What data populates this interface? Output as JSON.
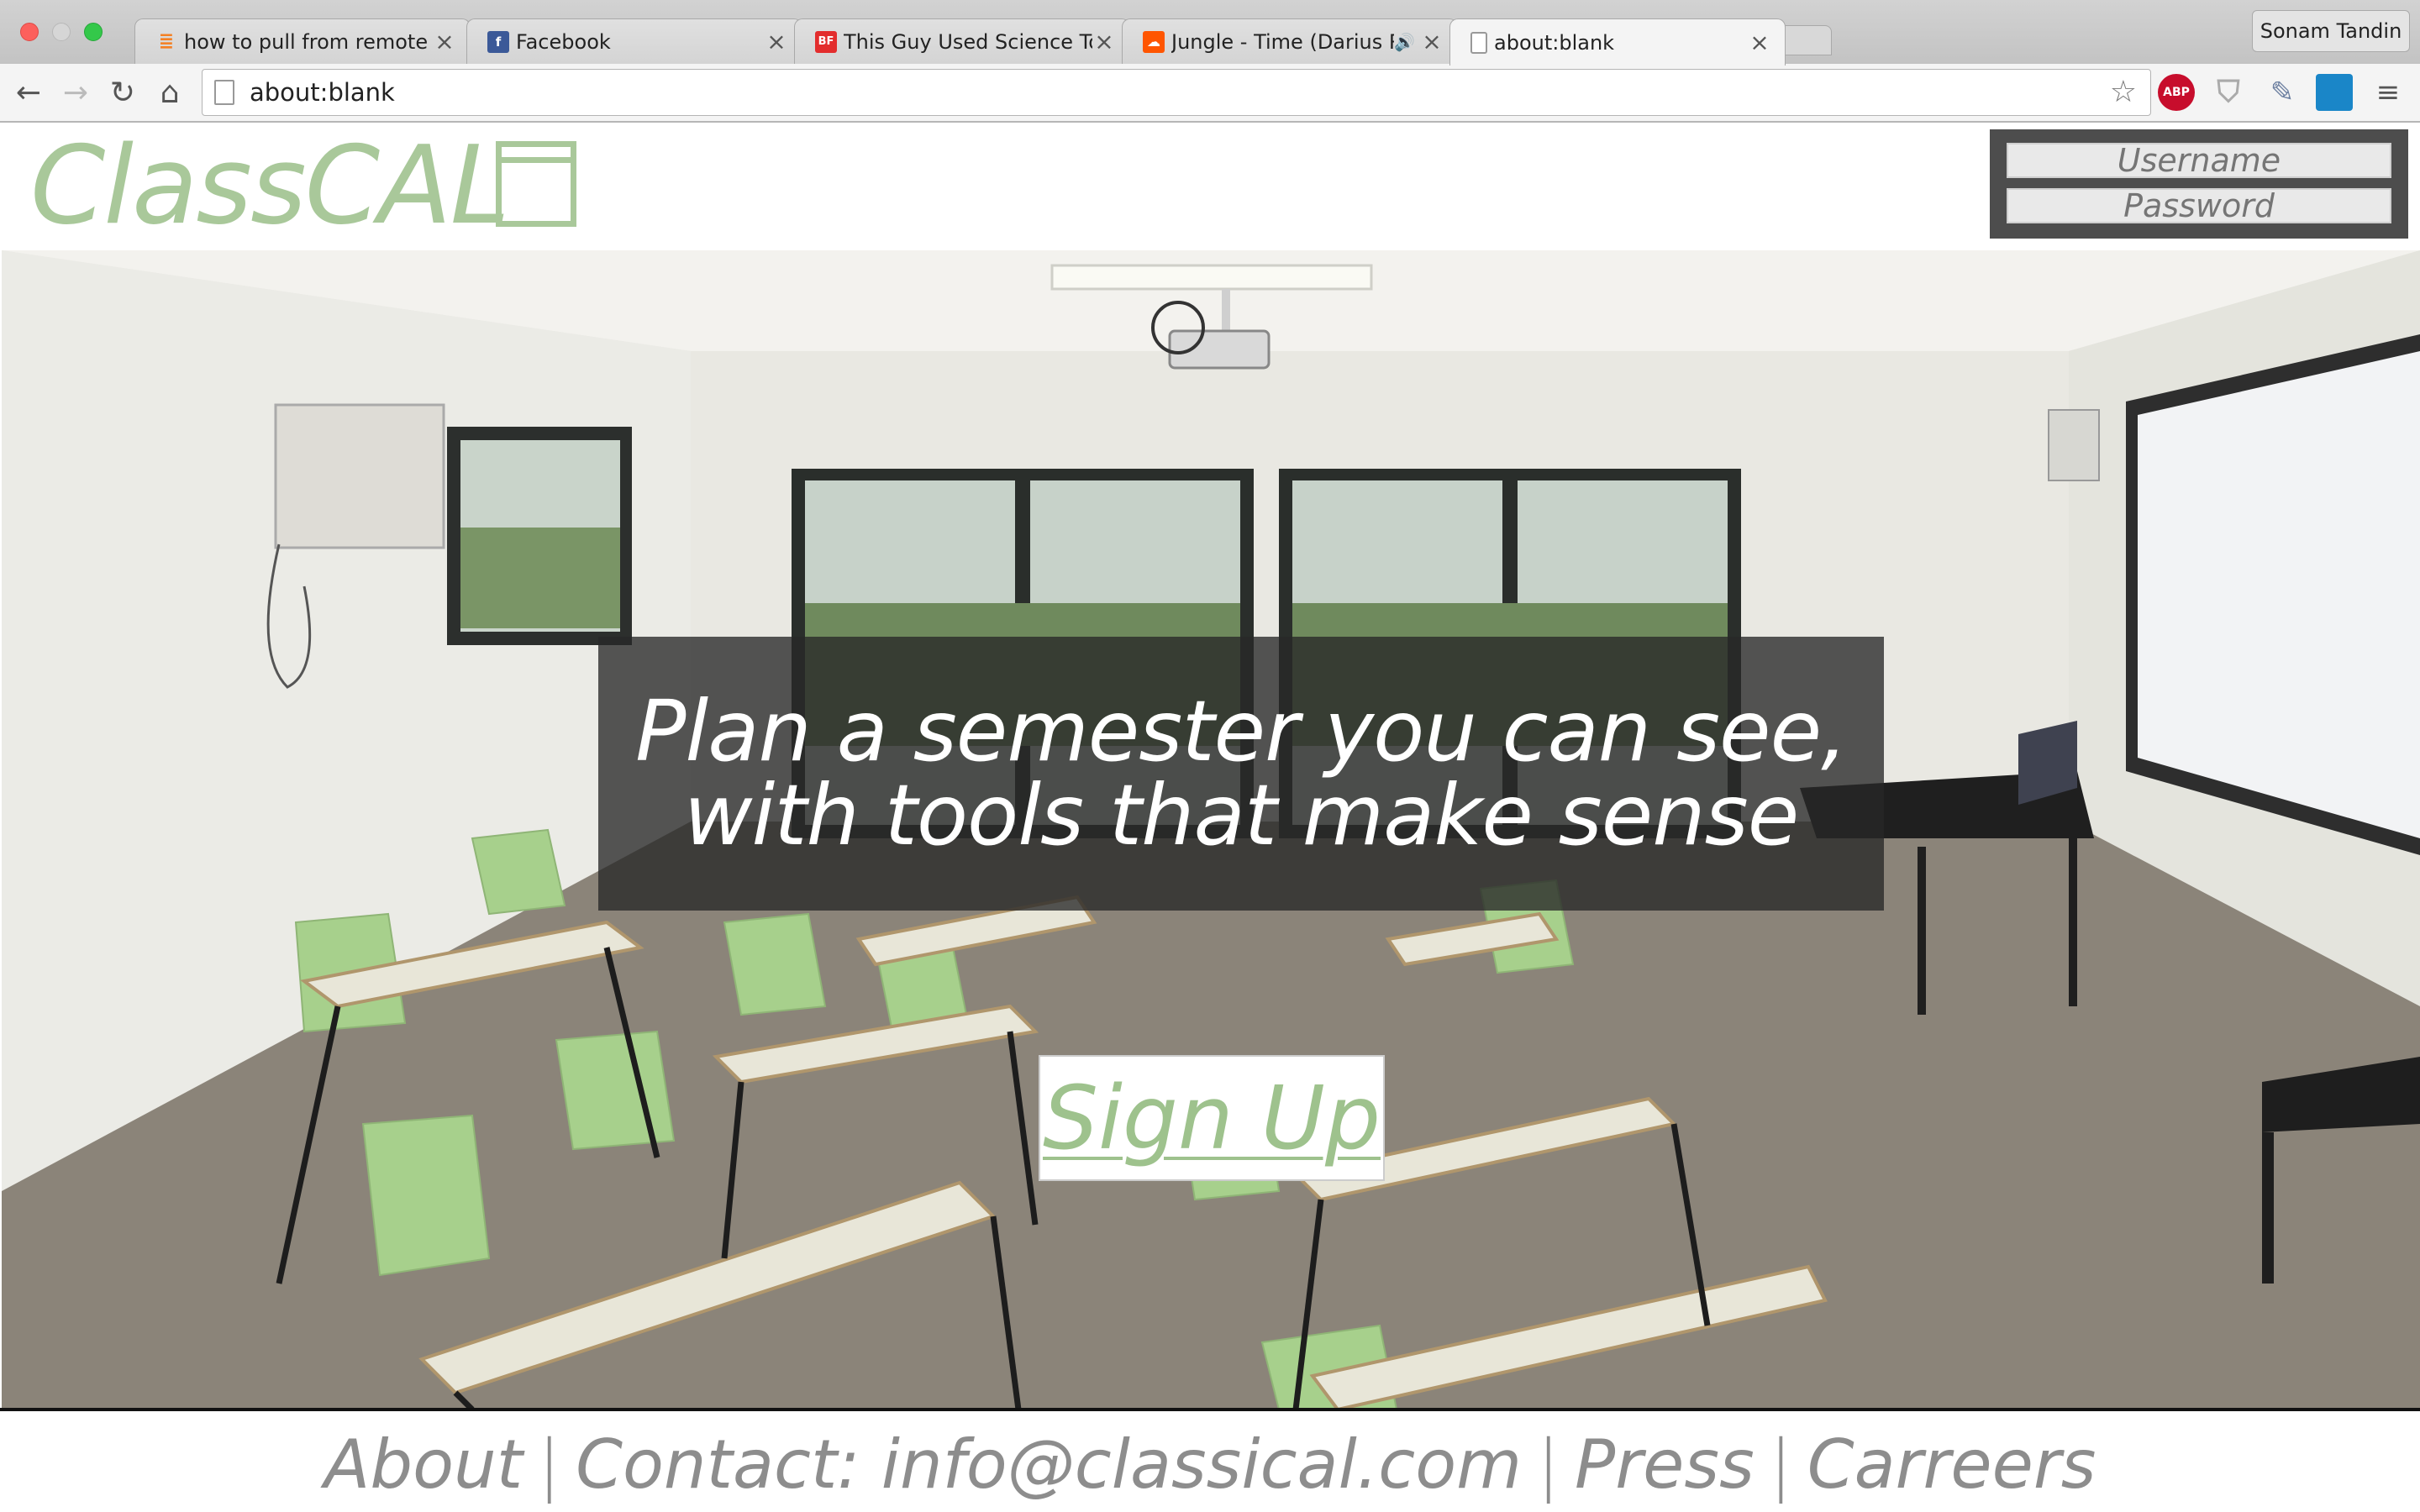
{
  "browser": {
    "profile_name": "Sonam Tandin",
    "url": "about:blank",
    "tabs": [
      {
        "title": "how to pull from remote git",
        "favicon": "stackoverflow-icon",
        "favicon_color": "#f48024"
      },
      {
        "title": "Facebook",
        "favicon": "facebook-icon",
        "favicon_color": "#3b5998",
        "favicon_text": "f"
      },
      {
        "title": "This Guy Used Science To",
        "favicon": "buzzfeed-icon",
        "favicon_color": "#e32d2d",
        "favicon_text": "BF"
      },
      {
        "title": "Jungle - Time (Darius Re",
        "favicon": "soundcloud-icon",
        "favicon_color": "#ff5500",
        "playing_audio": true
      },
      {
        "title": "about:blank",
        "favicon": "page-icon",
        "active": true
      }
    ],
    "extensions": [
      {
        "name": "adblock-plus-icon",
        "label": "ABP",
        "color": "#c70d2c"
      },
      {
        "name": "shield-icon",
        "label": "",
        "color": "#bcbcbc"
      },
      {
        "name": "eyedropper-icon",
        "label": "",
        "color": "#6c7fa0"
      },
      {
        "name": "extension-icon",
        "label": "",
        "color": "#1a86c8"
      }
    ]
  },
  "site": {
    "logo_text": "ClassCAL",
    "login": {
      "username_placeholder": "Username",
      "password_placeholder": "Password"
    },
    "hero": {
      "tagline_line1": "Plan a semester you can see,",
      "tagline_line2": "with tools that make sense",
      "cta_label": "Sign Up"
    },
    "footer": {
      "about": "About",
      "contact": "Contact: info@classical.com",
      "press": "Press",
      "careers": "Carreers",
      "separator": "|"
    },
    "colors": {
      "brand_green": "#a9c89a",
      "overlay": "#282828",
      "footer_text": "#8d8d8d"
    }
  }
}
